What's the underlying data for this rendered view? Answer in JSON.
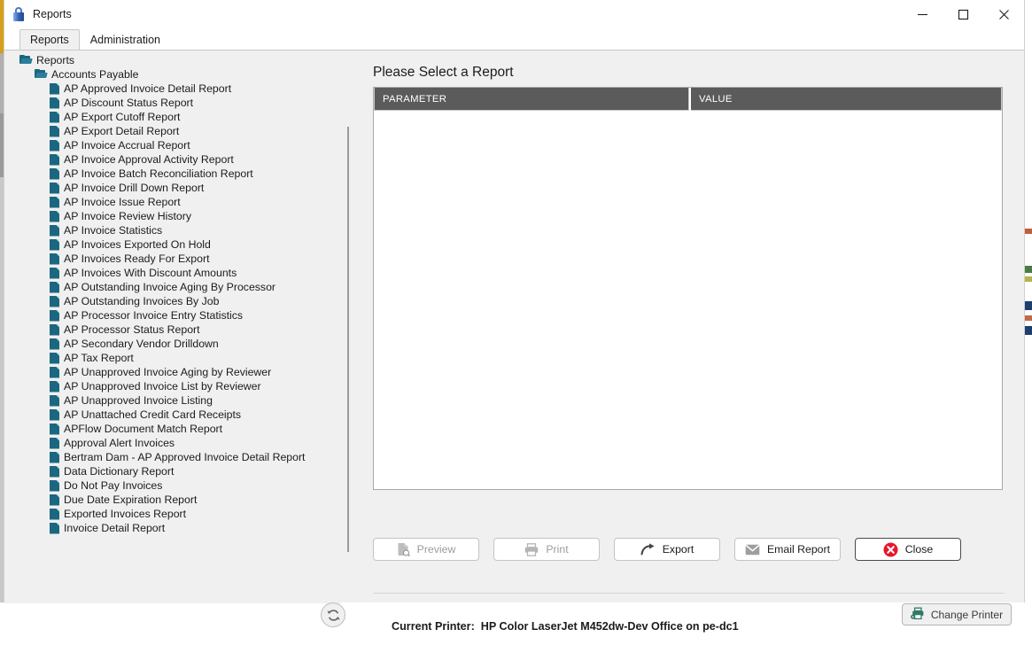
{
  "window": {
    "title": "Reports",
    "icon": "lock-icon",
    "controls": {
      "minimize": "minimize-icon",
      "maximize": "maximize-icon",
      "close": "close-icon"
    }
  },
  "tabs": [
    {
      "label": "Reports",
      "active": true
    },
    {
      "label": "Administration",
      "active": false
    }
  ],
  "tree": [
    {
      "label": "Reports",
      "level": 0,
      "type": "folder"
    },
    {
      "label": "Accounts Payable",
      "level": 1,
      "type": "folder"
    },
    {
      "label": "AP Approved Invoice Detail Report",
      "level": 2,
      "type": "file"
    },
    {
      "label": "AP Discount Status Report",
      "level": 2,
      "type": "file"
    },
    {
      "label": "AP Export Cutoff Report",
      "level": 2,
      "type": "file"
    },
    {
      "label": "AP Export Detail Report",
      "level": 2,
      "type": "file"
    },
    {
      "label": "AP Invoice Accrual Report",
      "level": 2,
      "type": "file"
    },
    {
      "label": "AP Invoice Approval Activity Report",
      "level": 2,
      "type": "file"
    },
    {
      "label": "AP Invoice Batch Reconciliation Report",
      "level": 2,
      "type": "file"
    },
    {
      "label": "AP Invoice Drill Down Report",
      "level": 2,
      "type": "file"
    },
    {
      "label": "AP Invoice Issue Report",
      "level": 2,
      "type": "file"
    },
    {
      "label": "AP Invoice Review History",
      "level": 2,
      "type": "file"
    },
    {
      "label": "AP Invoice Statistics",
      "level": 2,
      "type": "file"
    },
    {
      "label": "AP Invoices Exported On Hold",
      "level": 2,
      "type": "file"
    },
    {
      "label": "AP Invoices Ready For Export",
      "level": 2,
      "type": "file"
    },
    {
      "label": "AP Invoices With Discount Amounts",
      "level": 2,
      "type": "file"
    },
    {
      "label": "AP Outstanding Invoice Aging By Processor",
      "level": 2,
      "type": "file"
    },
    {
      "label": "AP Outstanding Invoices By Job",
      "level": 2,
      "type": "file"
    },
    {
      "label": "AP Processor Invoice Entry Statistics",
      "level": 2,
      "type": "file"
    },
    {
      "label": "AP Processor Status Report",
      "level": 2,
      "type": "file"
    },
    {
      "label": "AP Secondary Vendor Drilldown",
      "level": 2,
      "type": "file"
    },
    {
      "label": "AP Tax Report",
      "level": 2,
      "type": "file"
    },
    {
      "label": "AP Unapproved Invoice Aging by Reviewer",
      "level": 2,
      "type": "file"
    },
    {
      "label": "AP Unapproved Invoice List by Reviewer",
      "level": 2,
      "type": "file"
    },
    {
      "label": "AP Unapproved Invoice Listing",
      "level": 2,
      "type": "file"
    },
    {
      "label": "AP Unattached Credit Card Receipts",
      "level": 2,
      "type": "file"
    },
    {
      "label": "APFlow Document Match Report",
      "level": 2,
      "type": "file"
    },
    {
      "label": "Approval Alert Invoices",
      "level": 2,
      "type": "file"
    },
    {
      "label": "Bertram Dam - AP Approved Invoice Detail Report",
      "level": 2,
      "type": "file"
    },
    {
      "label": "Data Dictionary Report",
      "level": 2,
      "type": "file"
    },
    {
      "label": "Do Not Pay Invoices",
      "level": 2,
      "type": "file"
    },
    {
      "label": "Due Date Expiration Report",
      "level": 2,
      "type": "file"
    },
    {
      "label": "Exported Invoices Report",
      "level": 2,
      "type": "file"
    },
    {
      "label": "Invoice Detail Report",
      "level": 2,
      "type": "file"
    }
  ],
  "main": {
    "heading": "Please Select a Report",
    "grid": {
      "columns": [
        "PARAMETER",
        "VALUE"
      ],
      "rows": []
    }
  },
  "actions": [
    {
      "label": "Preview",
      "icon": "preview-icon",
      "state": "disabled"
    },
    {
      "label": "Print",
      "icon": "printer-icon",
      "state": "disabled"
    },
    {
      "label": "Export",
      "icon": "export-arrow-icon",
      "state": "enabled"
    },
    {
      "label": "Email Report",
      "icon": "envelope-icon",
      "state": "enabled"
    },
    {
      "label": "Close",
      "icon": "close-circle-icon",
      "state": "default"
    }
  ],
  "footer": {
    "refresh_icon": "refresh-icon",
    "printer_label": "Current Printer:",
    "printer_name": "HP Color LaserJet M452dw-Dev Office on pe-dc1",
    "change_printer_label": "Change Printer",
    "change_printer_icon": "printer-settings-icon"
  },
  "colors": {
    "tree_icon": "#1b6780",
    "grid_header_bg": "#5b5b5b",
    "close_icon_red": "#e8152b",
    "change_printer_icon": "#2f7a64",
    "panel_bg": "#f0f0f0"
  }
}
